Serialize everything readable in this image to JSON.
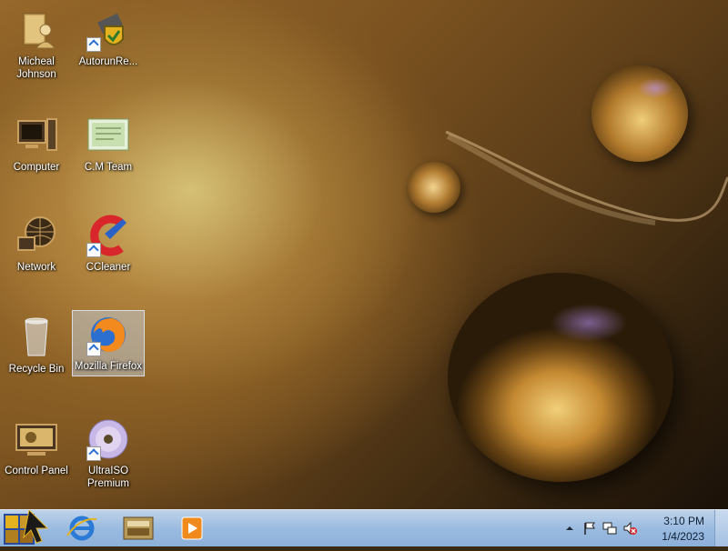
{
  "desktop": {
    "icons": [
      {
        "label": "Micheal Johnson",
        "icon": "user-folder-icon"
      },
      {
        "label": "AutorunRe...",
        "icon": "usb-shield-icon"
      },
      {
        "label": "Computer",
        "icon": "computer-icon"
      },
      {
        "label": "C.M Team",
        "icon": "document-icon"
      },
      {
        "label": "Network",
        "icon": "network-icon"
      },
      {
        "label": "CCleaner",
        "icon": "ccleaner-icon"
      },
      {
        "label": "Recycle Bin",
        "icon": "recycle-bin-icon"
      },
      {
        "label": "Mozilla Firefox",
        "icon": "firefox-icon"
      },
      {
        "label": "Control Panel",
        "icon": "control-panel-icon"
      },
      {
        "label": "UltraISO Premium",
        "icon": "disc-icon"
      }
    ]
  },
  "taskbar": {
    "pinned": [
      "internet-explorer-icon",
      "file-explorer-icon",
      "media-player-icon"
    ],
    "tray": [
      "show-hidden-arrow-icon",
      "action-center-flag-icon",
      "network-status-icon",
      "volume-muted-icon"
    ],
    "clock": {
      "time": "3:10 PM",
      "date": "1/4/2023"
    }
  },
  "colors": {
    "taskbar": "#9bbbe0",
    "selection": "#c8dcf5",
    "label_text": "#ffffff"
  }
}
